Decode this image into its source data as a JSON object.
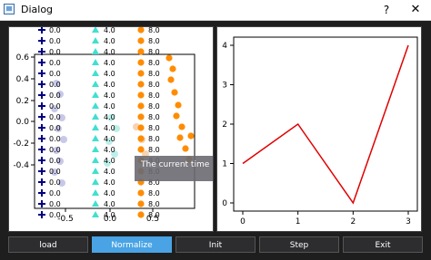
{
  "window": {
    "title": "Dialog",
    "help_label": "?",
    "close_label": "✕"
  },
  "left_chart": {
    "y_ticks": [
      "0.6",
      "0.4",
      "0.2",
      "0.0",
      "-0.2",
      "-0.4"
    ],
    "x_ticks": [
      "-0.5",
      "0.0",
      "0.5"
    ],
    "row_labels": [
      "0.0",
      "4.0",
      "8.0"
    ],
    "colors": {
      "plus": "#000080",
      "triangle": "#40e0d0",
      "circle": "#ff8c00"
    }
  },
  "chart_data": {
    "type": "line",
    "x": [
      0,
      1,
      2,
      3
    ],
    "y": [
      1,
      2,
      0,
      4
    ],
    "xlim": [
      0,
      3
    ],
    "ylim": [
      0,
      4
    ],
    "x_ticks": [
      "0",
      "1",
      "2",
      "3"
    ],
    "y_ticks": [
      "0",
      "1",
      "2",
      "3",
      "4"
    ],
    "color": "#e00000"
  },
  "tooltip": {
    "text": "The current time"
  },
  "buttons": [
    {
      "label": "load"
    },
    {
      "label": "Normalize"
    },
    {
      "label": "Init"
    },
    {
      "label": "Step"
    },
    {
      "label": "Exit"
    }
  ]
}
